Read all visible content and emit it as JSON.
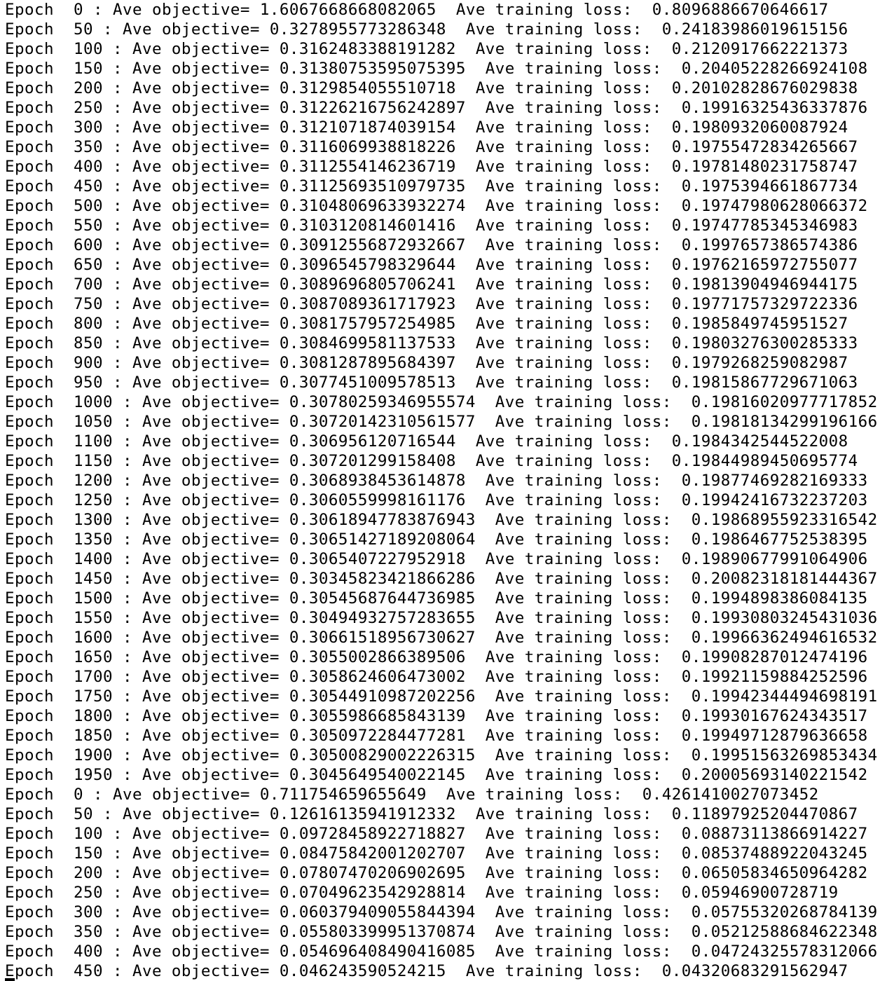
{
  "log": {
    "lines": [
      "Epoch  0 : Ave objective= 1.6067668668082065  Ave training loss:  0.8096886670646617",
      "Epoch  50 : Ave objective= 0.3278955773286348  Ave training loss:  0.24183986019615156",
      "Epoch  100 : Ave objective= 0.3162483388191282  Ave training loss:  0.2120917662221373",
      "Epoch  150 : Ave objective= 0.31380753595075395  Ave training loss:  0.20405228266924108",
      "Epoch  200 : Ave objective= 0.3129854055510718  Ave training loss:  0.20102828676029838",
      "Epoch  250 : Ave objective= 0.31226216756242897  Ave training loss:  0.19916325436337876",
      "Epoch  300 : Ave objective= 0.3121071874039154  Ave training loss:  0.1980932060087924",
      "Epoch  350 : Ave objective= 0.3116069938818226  Ave training loss:  0.19755472834265667",
      "Epoch  400 : Ave objective= 0.3112554146236719  Ave training loss:  0.19781480231758747",
      "Epoch  450 : Ave objective= 0.31125693510979735  Ave training loss:  0.1975394661867734",
      "Epoch  500 : Ave objective= 0.31048069633932274  Ave training loss:  0.19747980628066372",
      "Epoch  550 : Ave objective= 0.3103120814601416  Ave training loss:  0.19747785345346983",
      "Epoch  600 : Ave objective= 0.30912556872932667  Ave training loss:  0.1997657386574386",
      "Epoch  650 : Ave objective= 0.3096545798329644  Ave training loss:  0.19762165972755077",
      "Epoch  700 : Ave objective= 0.3089696805706241  Ave training loss:  0.19813904946944175",
      "Epoch  750 : Ave objective= 0.3087089361717923  Ave training loss:  0.19771757329722336",
      "Epoch  800 : Ave objective= 0.3081757957254985  Ave training loss:  0.1985849745951527",
      "Epoch  850 : Ave objective= 0.3084699581137533  Ave training loss:  0.19803276300285333",
      "Epoch  900 : Ave objective= 0.3081287895684397  Ave training loss:  0.1979268259082987",
      "Epoch  950 : Ave objective= 0.3077451009578513  Ave training loss:  0.19815867729671063",
      "Epoch  1000 : Ave objective= 0.30780259346955574  Ave training loss:  0.19816020977717852",
      "Epoch  1050 : Ave objective= 0.30720142310561577  Ave training loss:  0.19818134299196166",
      "Epoch  1100 : Ave objective= 0.306956120716544  Ave training loss:  0.1984342544522008",
      "Epoch  1150 : Ave objective= 0.307201299158408  Ave training loss:  0.19844989450695774",
      "Epoch  1200 : Ave objective= 0.3068938453614878  Ave training loss:  0.19877469282169333",
      "Epoch  1250 : Ave objective= 0.3060559998161176  Ave training loss:  0.19942416732237203",
      "Epoch  1300 : Ave objective= 0.30618947783876943  Ave training loss:  0.19868955923316542",
      "Epoch  1350 : Ave objective= 0.30651427189208064  Ave training loss:  0.1986467752538395",
      "Epoch  1400 : Ave objective= 0.3065407227952918  Ave training loss:  0.19890677991064906",
      "Epoch  1450 : Ave objective= 0.30345823421866286  Ave training loss:  0.20082318181444367",
      "Epoch  1500 : Ave objective= 0.30545687644736985  Ave training loss:  0.1994898386084135",
      "Epoch  1550 : Ave objective= 0.30494932757283655  Ave training loss:  0.19930803245431036",
      "Epoch  1600 : Ave objective= 0.30661518956730627  Ave training loss:  0.19966362494616532",
      "Epoch  1650 : Ave objective= 0.3055002866389506  Ave training loss:  0.19908287012474196",
      "Epoch  1700 : Ave objective= 0.3058624606473002  Ave training loss:  0.19921159884252596",
      "Epoch  1750 : Ave objective= 0.30544910987202256  Ave training loss:  0.19942344494698191",
      "Epoch  1800 : Ave objective= 0.3055986685843139  Ave training loss:  0.19930167624343517",
      "Epoch  1850 : Ave objective= 0.3050972284477281  Ave training loss:  0.19949712879636658",
      "Epoch  1900 : Ave objective= 0.30500829002226315  Ave training loss:  0.19951563269853434",
      "Epoch  1950 : Ave objective= 0.3045649540022145  Ave training loss:  0.20005693140221542",
      "Epoch  0 : Ave objective= 0.711754659655649  Ave training loss:  0.4261410027073452",
      "Epoch  50 : Ave objective= 0.12616135941912332  Ave training loss:  0.11897925204470867",
      "Epoch  100 : Ave objective= 0.09728458922718827  Ave training loss:  0.08873113866914227",
      "Epoch  150 : Ave objective= 0.08475842001202707  Ave training loss:  0.08537488922043245",
      "Epoch  200 : Ave objective= 0.07807470206902695  Ave training loss:  0.06505834650964282",
      "Epoch  250 : Ave objective= 0.07049623542928814  Ave training loss:  0.05946900728719",
      "Epoch  300 : Ave objective= 0.060379409055844394  Ave training loss:  0.05755320268784139",
      "Epoch  350 : Ave objective= 0.055803399951370874  Ave training loss:  0.05212588684622348",
      "Epoch  400 : Ave objective= 0.054696408490416085  Ave training loss:  0.04724325578312066",
      "Epoch  450 : Ave objective= 0.046243590524215  Ave training loss:  0.04320683291562947"
    ]
  }
}
